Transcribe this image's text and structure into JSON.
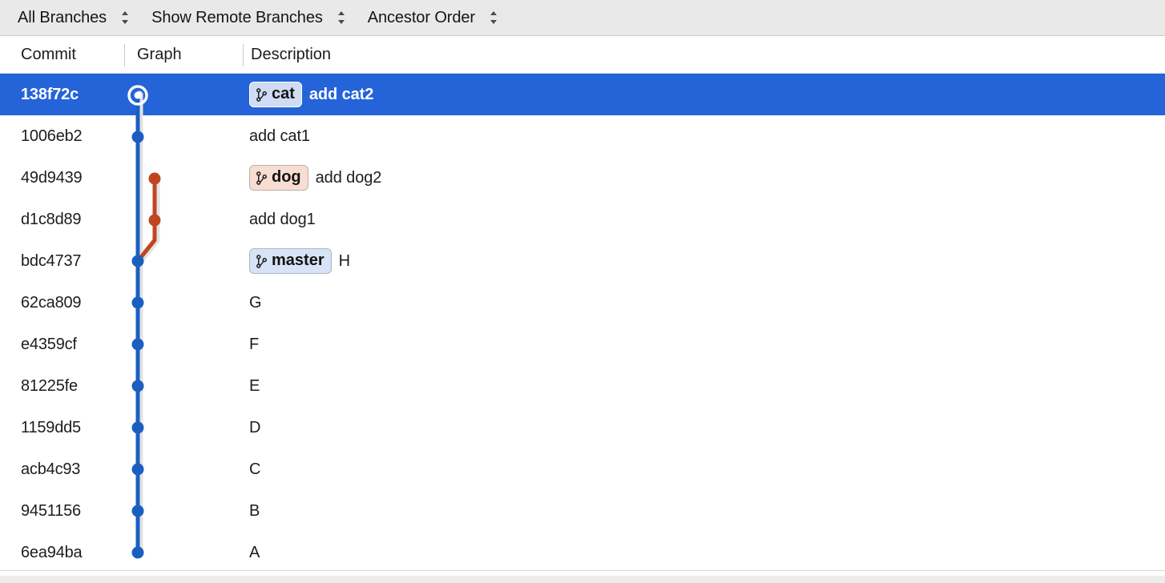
{
  "toolbar": {
    "filters": [
      {
        "label": "All Branches",
        "icon": "chevron-updown-icon"
      },
      {
        "label": "Show Remote Branches",
        "icon": "chevron-updown-icon"
      },
      {
        "label": "Ancestor Order",
        "icon": "chevron-updown-icon"
      }
    ]
  },
  "columns": [
    {
      "key": "commit",
      "label": "Commit"
    },
    {
      "key": "graph",
      "label": "Graph"
    },
    {
      "key": "description",
      "label": "Description"
    }
  ],
  "colors": {
    "selection_blue": "#2563d9",
    "lane_master": "#1a5fc0",
    "lane_dog": "#bf4520",
    "toolbar_bg": "#e9e9e9",
    "badge_cat_bg": "#cfdcf4",
    "badge_dog_bg": "#f8ddd2",
    "badge_master_bg": "#d7e3f6",
    "text": "#1d1d1d"
  },
  "commits": [
    {
      "hash": "138f72c",
      "description": "add cat2",
      "badge": {
        "name": "cat",
        "icon": "branch-icon",
        "style": "cat"
      },
      "selected": true,
      "head": true,
      "lane": "master"
    },
    {
      "hash": "1006eb2",
      "description": "add cat1",
      "badge": null,
      "selected": false,
      "head": false,
      "lane": "master"
    },
    {
      "hash": "49d9439",
      "description": "add dog2",
      "badge": {
        "name": "dog",
        "icon": "branch-icon",
        "style": "dog"
      },
      "selected": false,
      "head": false,
      "lane": "dog"
    },
    {
      "hash": "d1c8d89",
      "description": "add dog1",
      "badge": null,
      "selected": false,
      "head": false,
      "lane": "dog"
    },
    {
      "hash": "bdc4737",
      "description": "H",
      "badge": {
        "name": "master",
        "icon": "branch-icon",
        "style": "master"
      },
      "selected": false,
      "head": false,
      "lane": "master"
    },
    {
      "hash": "62ca809",
      "description": "G",
      "badge": null,
      "selected": false,
      "head": false,
      "lane": "master"
    },
    {
      "hash": "e4359cf",
      "description": "F",
      "badge": null,
      "selected": false,
      "head": false,
      "lane": "master"
    },
    {
      "hash": "81225fe",
      "description": "E",
      "badge": null,
      "selected": false,
      "head": false,
      "lane": "master"
    },
    {
      "hash": "1159dd5",
      "description": "D",
      "badge": null,
      "selected": false,
      "head": false,
      "lane": "master"
    },
    {
      "hash": "acb4c93",
      "description": "C",
      "badge": null,
      "selected": false,
      "head": false,
      "lane": "master"
    },
    {
      "hash": "9451156",
      "description": "B",
      "badge": null,
      "selected": false,
      "head": false,
      "lane": "master"
    },
    {
      "hash": "6ea94ba",
      "description": "A",
      "badge": null,
      "selected": false,
      "head": false,
      "lane": "master"
    }
  ]
}
